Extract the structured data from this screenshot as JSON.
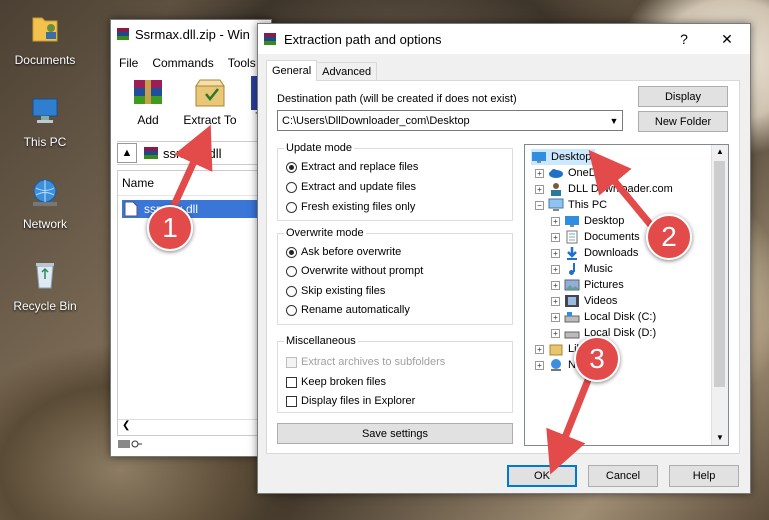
{
  "desktop": {
    "icons": [
      {
        "label": "Documents"
      },
      {
        "label": "This PC"
      },
      {
        "label": "Network"
      },
      {
        "label": "Recycle Bin"
      }
    ]
  },
  "winrar": {
    "title": "Ssrmax.dll.zip - Win",
    "menu": [
      "File",
      "Commands",
      "Tools"
    ],
    "toolbar": {
      "add_label": "Add",
      "extract_label": "Extract To",
      "partial_label": "T"
    },
    "path_value": "ssrmax.dll",
    "column_name": "Name",
    "file_name": "ssrmax.dll"
  },
  "dialog": {
    "title": "Extraction path and options",
    "help_char": "?",
    "close_char": "✕",
    "tabs": [
      "General",
      "Advanced"
    ],
    "dest_label": "Destination path (will be created if does not exist)",
    "dest_value": "C:\\Users\\DllDownloader_com\\Desktop",
    "display_btn": "Display",
    "new_folder_btn": "New Folder",
    "update_mode": {
      "title": "Update mode",
      "options": [
        "Extract and replace files",
        "Extract and update files",
        "Fresh existing files only"
      ],
      "selected": 0
    },
    "overwrite_mode": {
      "title": "Overwrite mode",
      "options": [
        "Ask before overwrite",
        "Overwrite without prompt",
        "Skip existing files",
        "Rename automatically"
      ],
      "selected": 0
    },
    "misc": {
      "title": "Miscellaneous",
      "options": [
        "Extract archives to subfolders",
        "Keep broken files",
        "Display files in Explorer"
      ]
    },
    "save_btn": "Save settings",
    "tree": [
      {
        "label": "Desktop",
        "selected": true
      },
      {
        "label": "OneDrive"
      },
      {
        "label": "DLL Downloader.com"
      },
      {
        "label": "This PC"
      },
      {
        "label": "Desktop"
      },
      {
        "label": "Documents"
      },
      {
        "label": "Downloads"
      },
      {
        "label": "Music"
      },
      {
        "label": "Pictures"
      },
      {
        "label": "Videos"
      },
      {
        "label": "Local Disk (C:)"
      },
      {
        "label": "Local Disk (D:)"
      },
      {
        "label": "Libraries"
      },
      {
        "label": "Network"
      }
    ],
    "ok_btn": "OK",
    "cancel_btn": "Cancel",
    "help_btn": "Help"
  },
  "markers": [
    "1",
    "2",
    "3"
  ],
  "colors": {
    "marker": "#e34a4a",
    "selection": "#cce8ff",
    "accent": "#0078d7"
  }
}
